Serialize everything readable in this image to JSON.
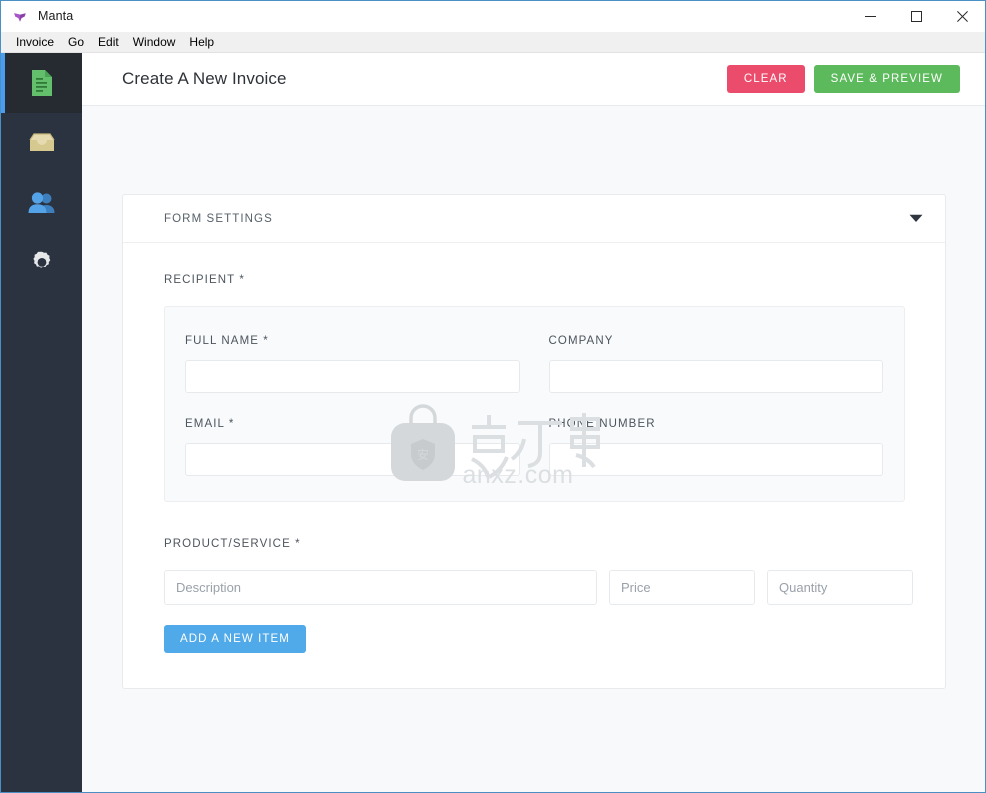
{
  "window": {
    "app_icon": "manta-logo-icon",
    "title": "Manta",
    "controls": {
      "minimize": "minimize-icon",
      "maximize": "maximize-icon",
      "close": "close-icon"
    }
  },
  "menubar": {
    "items": [
      {
        "label": "Invoice"
      },
      {
        "label": "Go"
      },
      {
        "label": "Edit"
      },
      {
        "label": "Window"
      },
      {
        "label": "Help"
      }
    ]
  },
  "sidebar": {
    "items": [
      {
        "icon": "document-icon",
        "name": "invoices",
        "active": true
      },
      {
        "icon": "inbox-tray-icon",
        "name": "inbox",
        "active": false
      },
      {
        "icon": "people-icon",
        "name": "clients",
        "active": false
      },
      {
        "icon": "gear-icon",
        "name": "settings",
        "active": false
      }
    ]
  },
  "header": {
    "title": "Create A New Invoice",
    "clear_label": "CLEAR",
    "save_label": "SAVE & PREVIEW",
    "clear_color": "#ec4c6b",
    "save_color": "#5cba5c"
  },
  "form": {
    "settings_header": "FORM SETTINGS",
    "settings_caret": "chevron-down-icon",
    "recipient": {
      "section_label": "RECIPIENT *",
      "fields": [
        {
          "label": "FULL NAME *",
          "value": "",
          "placeholder": "",
          "name": "full-name"
        },
        {
          "label": "COMPANY",
          "value": "",
          "placeholder": "",
          "name": "company"
        },
        {
          "label": "EMAIL *",
          "value": "",
          "placeholder": "",
          "name": "email"
        },
        {
          "label": "PHONE NUMBER",
          "value": "",
          "placeholder": "",
          "name": "phone-number"
        }
      ]
    },
    "product": {
      "section_label": "PRODUCT/SERVICE *",
      "description_placeholder": "Description",
      "price_placeholder": "Price",
      "quantity_placeholder": "Quantity",
      "description_value": "",
      "price_value": "",
      "quantity_value": "",
      "add_item_label": "ADD A NEW ITEM",
      "add_item_color": "#50a9e8"
    }
  },
  "watermark": {
    "text": "anxz.com",
    "chinese_text": "安下载",
    "logo": "bag-logo-icon"
  }
}
